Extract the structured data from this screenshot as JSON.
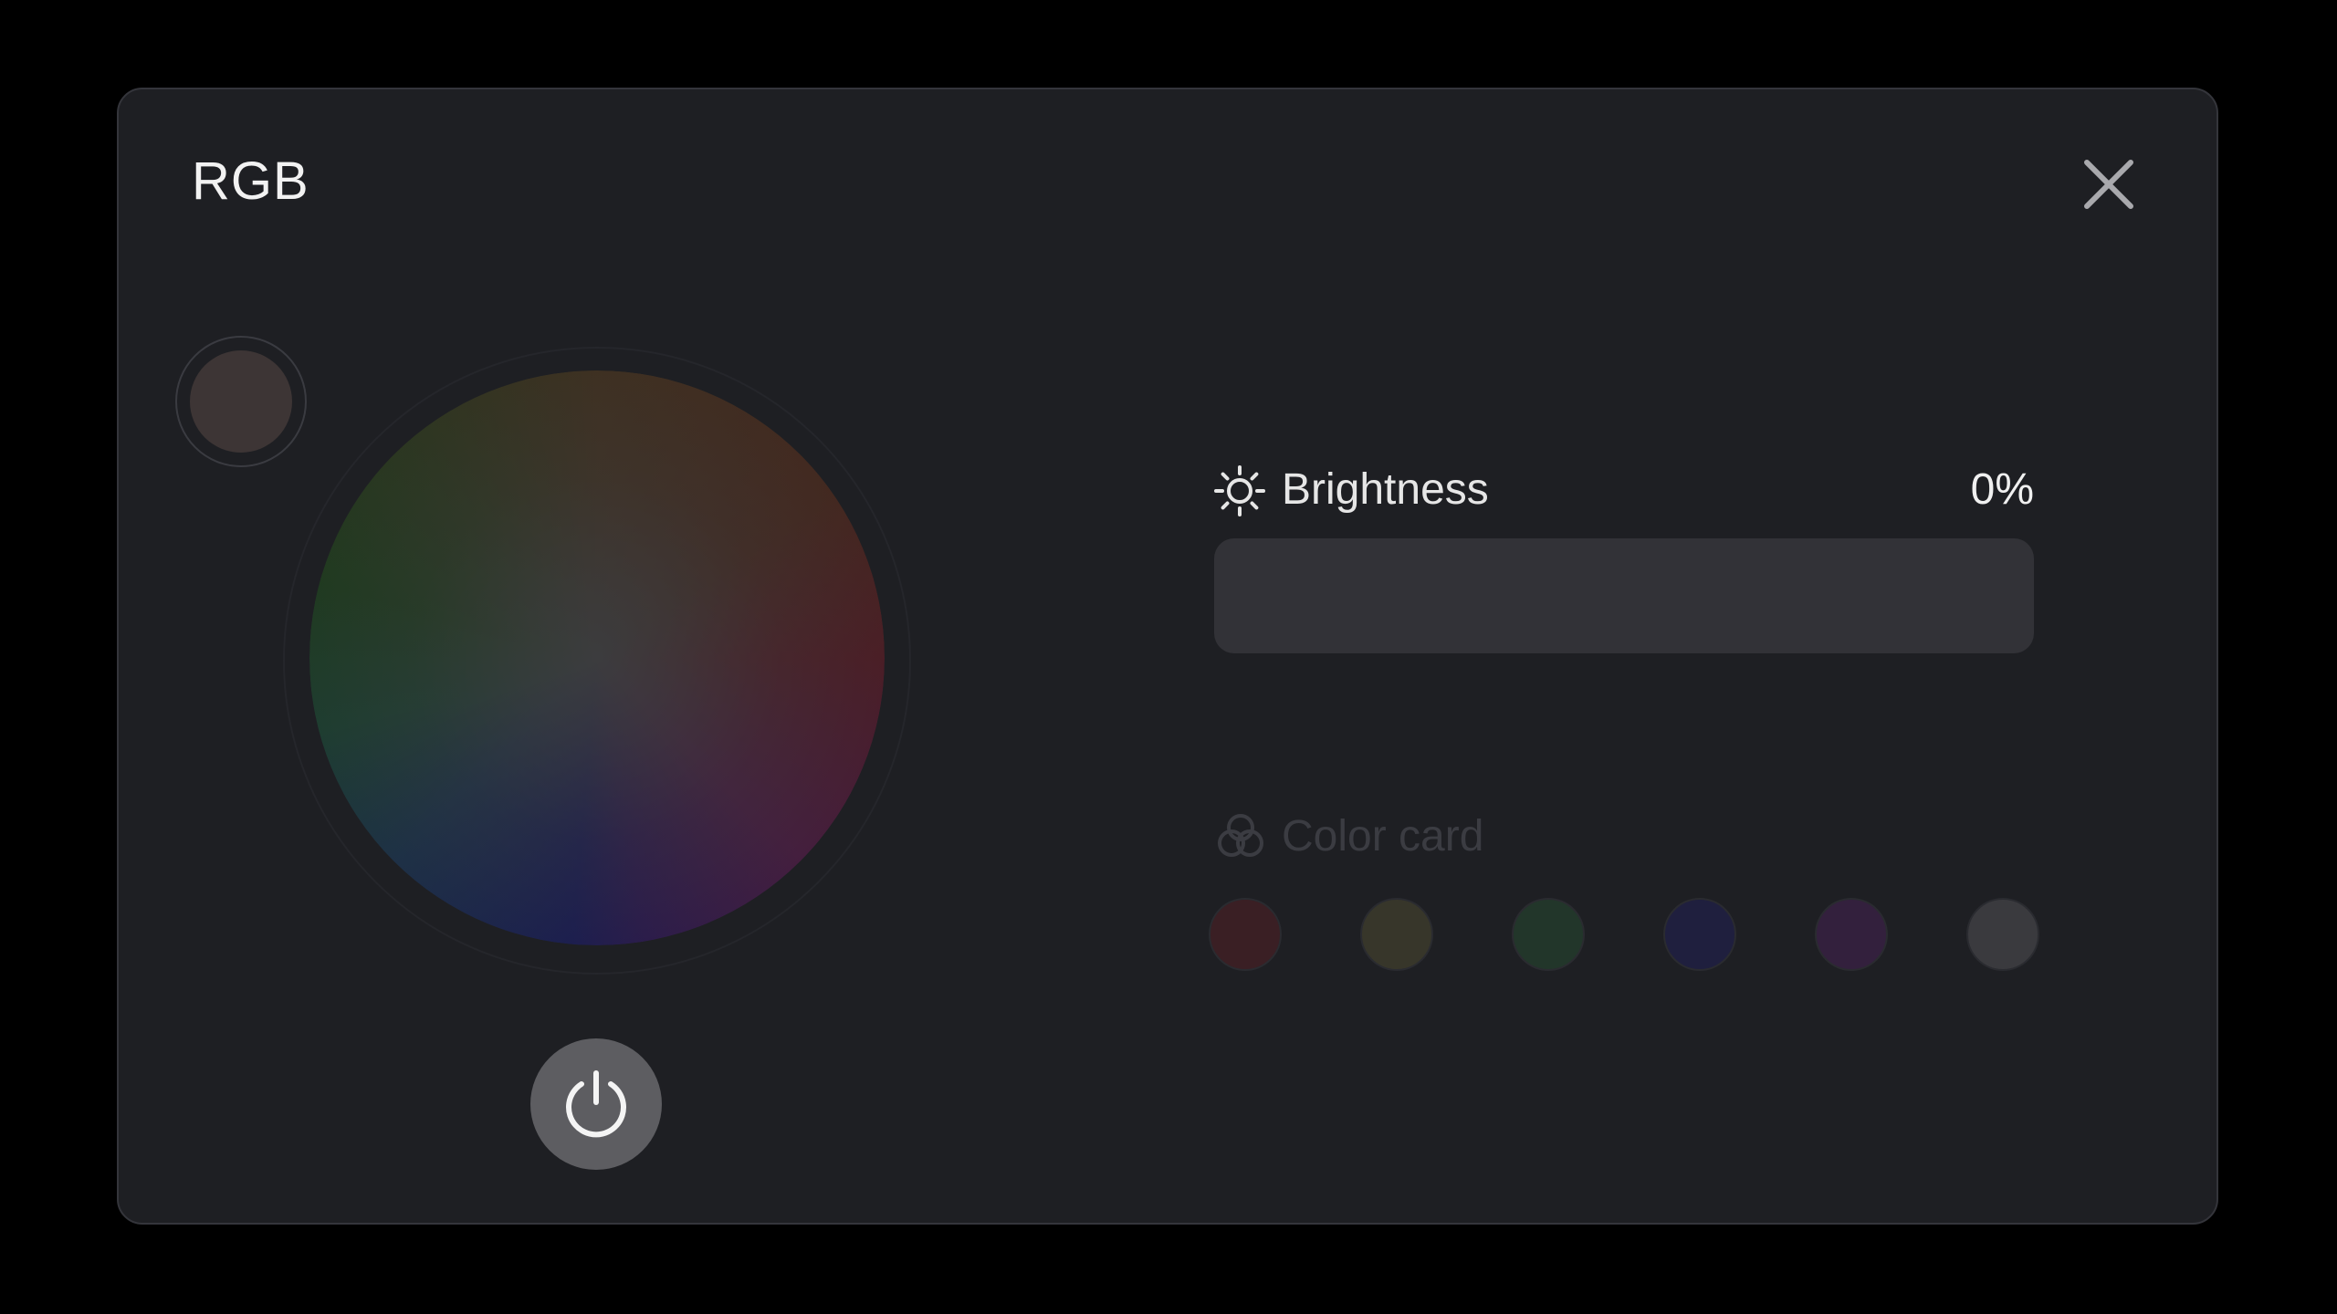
{
  "dialog": {
    "title": "RGB"
  },
  "preview": {
    "color": "#3d3535"
  },
  "brightness": {
    "label": "Brightness",
    "value_text": "0%",
    "value": 0
  },
  "color_card": {
    "label": "Color card",
    "swatches": [
      {
        "name": "red",
        "color": "#3a1f24"
      },
      {
        "name": "yellow",
        "color": "#37362a"
      },
      {
        "name": "green",
        "color": "#22362a"
      },
      {
        "name": "blue",
        "color": "#1f1f3e"
      },
      {
        "name": "purple",
        "color": "#33203d"
      },
      {
        "name": "white",
        "color": "#3a3a3e"
      }
    ]
  },
  "colors": {
    "dialog_bg": "#1e1f23",
    "slider_track": "#323237",
    "power_button": "#5d5d61"
  },
  "icons": {
    "close": "close-icon",
    "sun": "sun-icon",
    "color_card": "color-circles-icon",
    "power": "power-icon"
  }
}
